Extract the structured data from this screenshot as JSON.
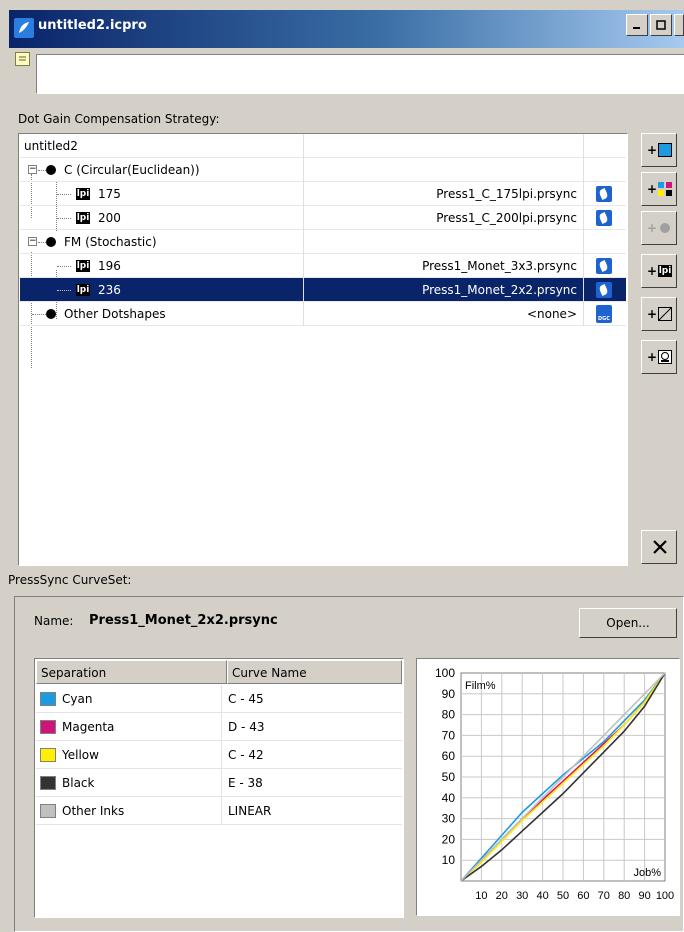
{
  "window": {
    "title": "untitled2.icpro"
  },
  "sections": {
    "strategy_label": "Dot Gain Compensation Strategy:",
    "curveset_label": "PressSync CurveSet:"
  },
  "tree": {
    "root": "untitled2",
    "nodes": [
      {
        "label": "C (Circular(Euclidean))",
        "file": ""
      },
      {
        "label": "175",
        "file": "Press1_C_175lpi.prsync"
      },
      {
        "label": "200",
        "file": "Press1_C_200lpi.prsync"
      },
      {
        "label": "FM (Stochastic)",
        "file": ""
      },
      {
        "label": "196",
        "file": "Press1_Monet_3x3.prsync"
      },
      {
        "label": "236",
        "file": "Press1_Monet_2x2.prsync"
      },
      {
        "label": "Other Dotshapes",
        "file": "<none>"
      }
    ],
    "lpi_badge": "lpi",
    "dgc_badge": "DGC"
  },
  "tools": {
    "plus": "+",
    "lpi": "lpi"
  },
  "curveset": {
    "name_label": "Name:",
    "name_value": "Press1_Monet_2x2.prsync",
    "open_button": "Open...",
    "columns": [
      "Separation",
      "Curve Name"
    ],
    "rows": [
      {
        "separation": "Cyan",
        "curve": "C - 45",
        "color": "#1e9be0"
      },
      {
        "separation": "Magenta",
        "curve": "D - 43",
        "color": "#d0157a"
      },
      {
        "separation": "Yellow",
        "curve": "C - 42",
        "color": "#ffef00"
      },
      {
        "separation": "Black",
        "curve": "E - 38",
        "color": "#333333"
      },
      {
        "separation": "Other Inks",
        "curve": "LINEAR",
        "color": "#c0c0c0"
      }
    ]
  },
  "chart_data": {
    "type": "line",
    "ylabel": "Film%",
    "xlabel": "Job%",
    "xlim": [
      0,
      100
    ],
    "ylim": [
      0,
      100
    ],
    "xticks": [
      "10",
      "20",
      "30",
      "40",
      "50",
      "60",
      "70",
      "80",
      "90",
      "100"
    ],
    "yticks": [
      "10",
      "20",
      "30",
      "40",
      "50",
      "60",
      "70",
      "80",
      "90",
      "100"
    ],
    "grid": true,
    "series": [
      {
        "color": "#1e9be0",
        "x": [
          0,
          10,
          20,
          30,
          40,
          50,
          60,
          70,
          80,
          90,
          100
        ],
        "y": [
          0,
          11,
          22,
          33,
          42,
          51,
          59,
          67,
          77,
          87,
          100
        ]
      },
      {
        "color": "#d0157a",
        "x": [
          0,
          10,
          20,
          30,
          40,
          50,
          60,
          70,
          80,
          90,
          100
        ],
        "y": [
          0,
          10,
          20,
          30,
          39,
          48,
          57,
          66,
          75,
          86,
          100
        ]
      },
      {
        "color": "#ffef00",
        "x": [
          0,
          10,
          20,
          30,
          40,
          50,
          60,
          70,
          80,
          90,
          100
        ],
        "y": [
          0,
          9,
          19,
          29,
          38,
          47,
          56,
          65,
          75,
          86,
          100
        ]
      },
      {
        "color": "#333333",
        "x": [
          0,
          10,
          20,
          30,
          40,
          50,
          60,
          70,
          80,
          90,
          100
        ],
        "y": [
          0,
          7,
          15,
          24,
          33,
          42,
          52,
          62,
          72,
          84,
          100
        ]
      },
      {
        "color": "#c0c0c0",
        "x": [
          0,
          100
        ],
        "y": [
          0,
          100
        ]
      }
    ]
  }
}
